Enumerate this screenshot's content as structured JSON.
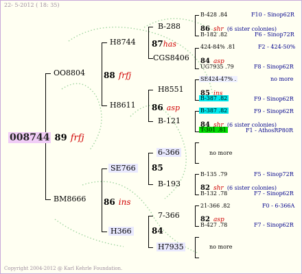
{
  "header": {
    "date": "22- 5-2012 ( 18: 35)"
  },
  "footer": {
    "copyright": "Copyright 2004-2012 @ Karl Kehrle Foundation."
  },
  "root": {
    "id": "008744",
    "year": "89",
    "mark": "frfj"
  },
  "gen1": {
    "father": {
      "id": "OO8804",
      "year": "88",
      "mark": "frfj"
    },
    "mother": {
      "id": "BM8666",
      "year": "86",
      "mark": "ins"
    }
  },
  "gen2": {
    "ff": {
      "id": "H8744",
      "year": "87",
      "mark": "has"
    },
    "fm": {
      "id": "H8611",
      "year": "86",
      "mark": "asp"
    },
    "mf": {
      "id": "SE766",
      "year": "85",
      "mark": ""
    },
    "mm": {
      "id": "H366",
      "year": "84",
      "mark": ""
    }
  },
  "gen3": {
    "fff": "B-288",
    "ffm": "CGS8406",
    "fmf": "H8551",
    "fmm": "B-121",
    "mff": "6-366",
    "mfm": "B-193",
    "mmf": "7-366",
    "mmm": "H7935"
  },
  "gen4": {
    "b1": {
      "top": "B-428 .84",
      "top_link": "F10 - Sinop62R",
      "year": "86",
      "mark": "shr",
      "note": "(6 sister colonies)",
      "bottom": "B-182 .82",
      "bottom_link": "F6 - Sinop72R"
    },
    "b2": {
      "top": "424-84% .81",
      "top_link": "F2 - 424-50%",
      "year": "84",
      "mark": "asp",
      "bottom": "UG7935 .79",
      "bottom_link": "F8 - Sinop62R"
    },
    "b3": {
      "top": "SE424-47% .",
      "top_link": "no more",
      "year": "85",
      "mark": "ins",
      "bottom": "B-387 .82",
      "bottom_link": "F9 - Sinop62R"
    },
    "b4": {
      "top": "B-387 .82",
      "top_link": "F9 - Sinop62R",
      "year": "84",
      "mark": "shr",
      "note": "(6 sister colonies)",
      "bottom": "T-301 .81",
      "bottom_link": "F1 - AthosRP80R"
    },
    "b5": {
      "no_more": "no more"
    },
    "b6": {
      "top": "B-135 .79",
      "top_link": "F5 - Sinop72R",
      "year": "82",
      "mark": "shr",
      "note": "(6 sister colonies)",
      "bottom": "B-132 .78",
      "bottom_link": "F7 - Sinop62R"
    },
    "b7": {
      "top": "21-366 .82",
      "top_link": "F0 - 6-366A",
      "year": "82",
      "mark": "asp",
      "bottom": "B-427 .78",
      "bottom_link": "F7 - Sinop62R"
    },
    "b8": {
      "no_more": "no more"
    }
  }
}
